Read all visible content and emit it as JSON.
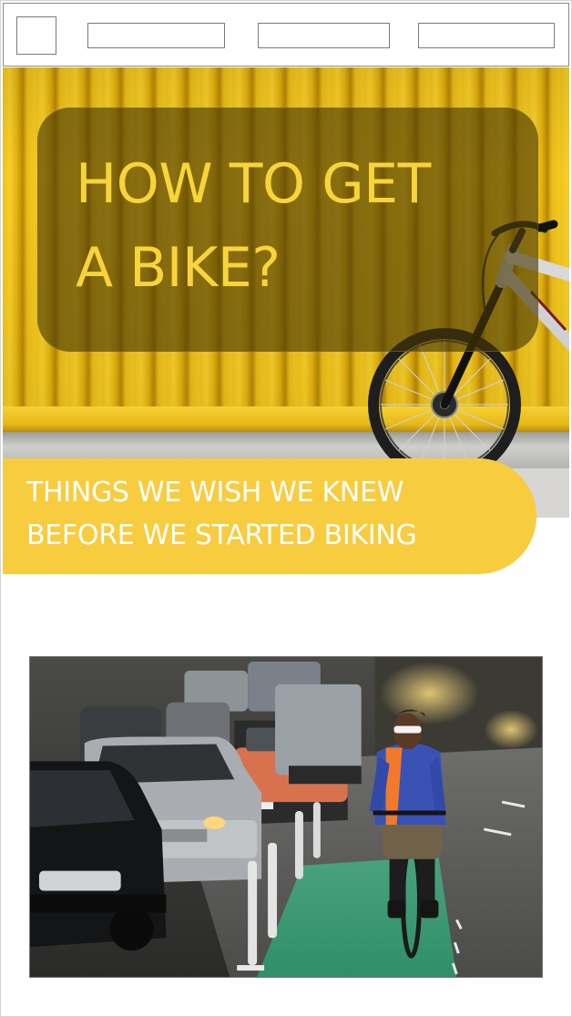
{
  "navbar": {
    "logo_icon": "logo-placeholder-icon",
    "links": [
      "",
      "",
      ""
    ]
  },
  "hero": {
    "title_line_1": "HOW TO GET",
    "title_line_2": "A BIKE?",
    "image_subject": "bike-leaning-on-yellow-wall"
  },
  "banner": {
    "line_1": "THINGS WE WISH WE KNEW",
    "line_2": "BEFORE WE STARTED BIKING"
  },
  "photo": {
    "image_subject": "cyclist-in-bike-lane-beside-traffic"
  },
  "colors": {
    "accent_yellow": "#f8cc3f",
    "title_yellow": "#f7d43a",
    "overlay": "#463705",
    "bike_lane_green": "#2f9a6c"
  }
}
